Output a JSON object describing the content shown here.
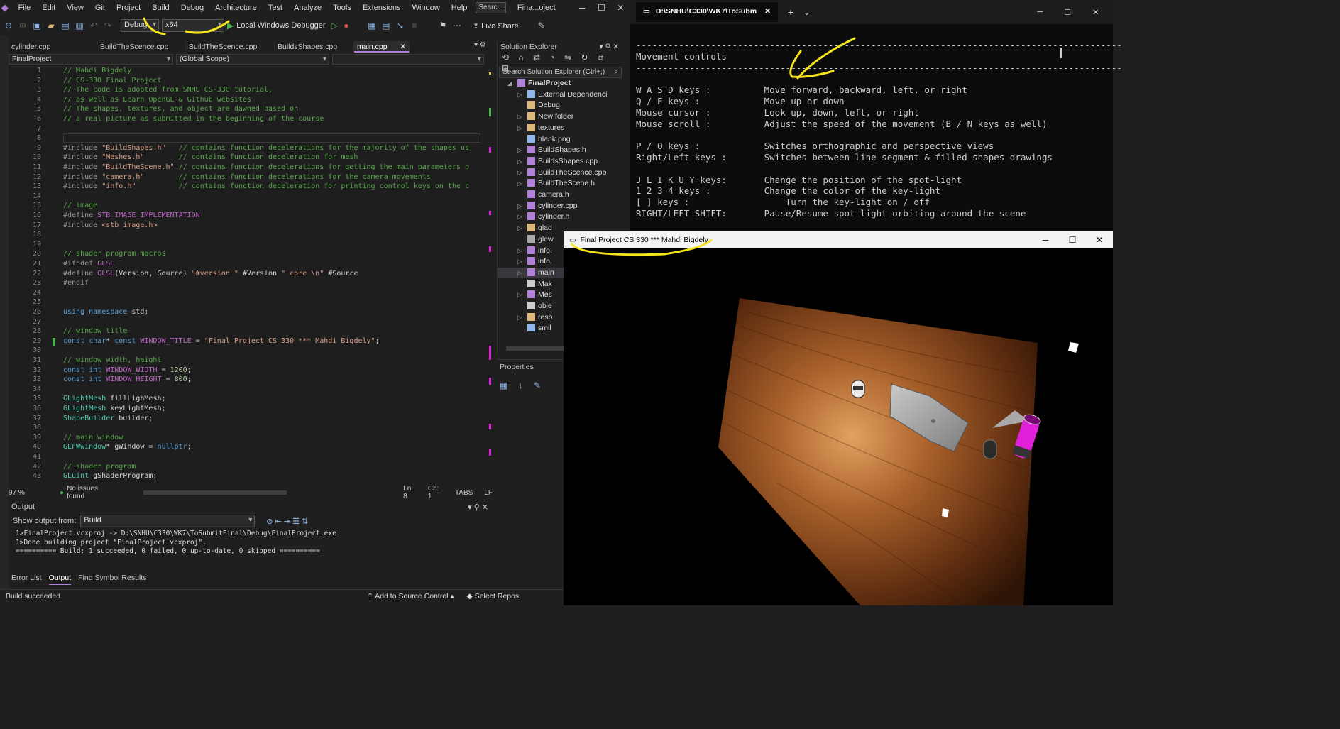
{
  "vs": {
    "menu": [
      "File",
      "Edit",
      "View",
      "Git",
      "Project",
      "Build",
      "Debug",
      "Architecture",
      "Test",
      "Analyze",
      "Tools",
      "Extensions",
      "Window",
      "Help"
    ],
    "search": "Searc...",
    "title": "Fina...oject",
    "config": "Debug",
    "platform": "x64",
    "debugger": "Local Windows Debugger",
    "liveshare": "Live Share",
    "tabs": [
      "cylinder.cpp",
      "BuildTheScence.cpp",
      "BuildTheScence.cpp",
      "BuildsShapes.cpp",
      "main.cpp"
    ],
    "nav_project": "FinalProject",
    "nav_scope": "(Global Scope)",
    "zoom": "97 %",
    "issues": "No issues found",
    "ln": "Ln: 8",
    "ch": "Ch: 1",
    "tabs_mode": "TABS",
    "eol": "LF",
    "output_title": "Output",
    "output_from_label": "Show output from:",
    "output_from": "Build",
    "output_lines": [
      "1>FinalProject.vcxproj -> D:\\SNHU\\C330\\WK7\\ToSubmitFinal\\Debug\\FinalProject.exe",
      "1>Done building project \"FinalProject.vcxproj\".",
      "========== Build: 1 succeeded, 0 failed, 0 up-to-date, 0 skipped =========="
    ],
    "bottom_tabs": [
      "Error List",
      "Output",
      "Find Symbol Results"
    ],
    "status": "Build succeeded",
    "add_source": "Add to Source Control",
    "select_repo": "Select Repos",
    "solution_explorer": "Solution Explorer",
    "se_search": "Search Solution Explorer (Ctrl+;)",
    "se_items": [
      "FinalProject",
      "External Dependenci",
      "Debug",
      "New folder",
      "textures",
      "blank.png",
      "BuildShapes.h",
      "BuildsShapes.cpp",
      "BuildTheScence.cpp",
      "BuildTheScene.h",
      "camera.h",
      "cylinder.cpp",
      "cylinder.h",
      "glad",
      "glew",
      "info.",
      "info.",
      "main",
      "Mak",
      "Mes",
      "obje",
      "reso",
      "smil"
    ],
    "properties": "Properties"
  },
  "code": [
    "// Mahdi Bigdely",
    "// CS-330 Final Project",
    "// The code is adopted from SNHU CS-330 tutorial,",
    "// as well as Learn OpenGL & Github websites",
    "// The shapes, textures, and object are dawned based on",
    "// a real picture as submitted in the beginning of the course",
    "",
    "",
    "#include \"BuildShapes.h\"   // contains function decelerations for the majority of the shapes us",
    "#include \"Meshes.h\"        // contains function deceleration for mesh",
    "#include \"BuildTheScene.h\" // contains function decelerations for getting the main parameters o",
    "#include \"camera.h\"        // contains function decelerations for the camera movements",
    "#include \"info.h\"          // contains function deceleration for printing control keys on the c",
    "",
    "// image",
    "#define STB_IMAGE_IMPLEMENTATION",
    "#include <stb_image.h>",
    "",
    "",
    "// shader program macros",
    "#ifndef GLSL",
    "#define GLSL(Version, Source) \"#version \" #Version \" core \\n\" #Source",
    "#endif",
    "",
    "",
    "using namespace std;",
    "",
    "// window title",
    "const char* const WINDOW_TITLE = \"Final Project CS 330 *** Mahdi Bigdely\";",
    "",
    "// window width, height",
    "const int WINDOW_WIDTH = 1200;",
    "const int WINDOW_HEIGHT = 800;",
    "",
    "GLightMesh fillLighMesh;",
    "GLightMesh keyLightMesh;",
    "ShapeBuilder builder;",
    "",
    "// main window",
    "GLFWwindow* gWindow = nullptr;",
    "",
    "// shader program",
    "GLuint gShaderProgram;"
  ],
  "terminal": {
    "tab_title": "D:\\SNHU\\C330\\WK7\\ToSubm",
    "separator": "-------------------------------------------------------------------------------------------",
    "heading": "Movement controls",
    "rows": [
      [
        "W A S D keys :",
        "Move forward, backward, left, or right"
      ],
      [
        "Q / E keys :",
        "Move up or down"
      ],
      [
        "Mouse cursor :",
        "Look up, down, left, or right"
      ],
      [
        "Mouse scroll :",
        "Adjust the speed of the movement (B / N keys as well)"
      ],
      [
        "",
        ""
      ],
      [
        "P / O keys :",
        "Switches orthographic and perspective views"
      ],
      [
        "Right/Left keys :",
        "Switches between line segment & filled shapes drawings"
      ],
      [
        "",
        ""
      ],
      [
        "J L I K U Y keys:",
        "Change the position of the spot-light"
      ],
      [
        "1 2 3 4 keys :",
        "Change the color of the key-light"
      ],
      [
        "[ ] keys :",
        "    Turn the key-light on / off"
      ],
      [
        "RIGHT/LEFT SHIFT:",
        "Pause/Resume spot-light orbiting around the scene"
      ]
    ]
  },
  "game": {
    "title": "Final Project CS 330 *** Mahdi Bigdely"
  },
  "colors": {
    "accent": "#b180d7",
    "annotation": "#f5e31b",
    "magenta_obj": "#e020d8"
  }
}
